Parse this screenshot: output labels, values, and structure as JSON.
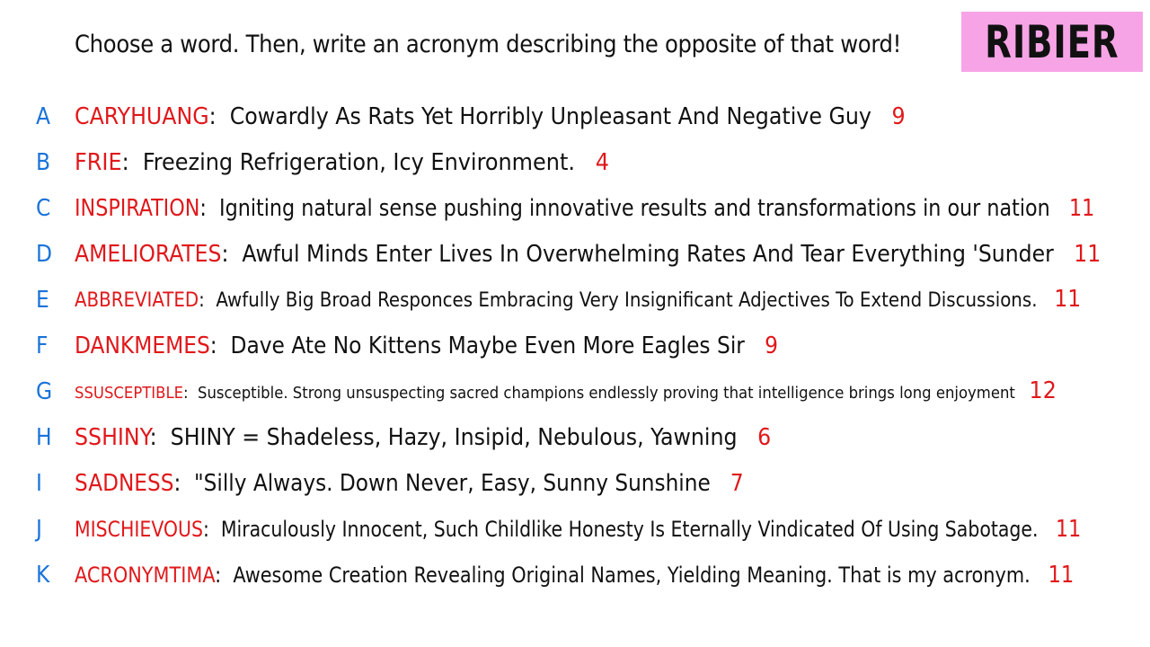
{
  "prompt": "Choose a word. Then, write an acronym describing the opposite of that word!",
  "player_name": "RIBIER",
  "colors": {
    "letter": "#1a73d9",
    "word": "#e0181b",
    "score": "#e0181b",
    "name_tag_bg": "#f7a4e6"
  },
  "answers": [
    {
      "letter": "A",
      "word": "CARYHUANG",
      "definition": "Cowardly As Rats Yet Horribly Unpleasant And Negative Guy",
      "score": "9"
    },
    {
      "letter": "B",
      "word": "FRIE",
      "definition": "Freezing Refrigeration, Icy Environment.",
      "score": "4"
    },
    {
      "letter": "C",
      "word": "INSPIRATION",
      "definition": "Igniting natural sense pushing innovative results and transformations in our nation",
      "score": "11"
    },
    {
      "letter": "D",
      "word": "AMELIORATES",
      "definition": "Awful Minds Enter Lives In Overwhelming Rates And Tear Everything 'Sunder",
      "score": "11"
    },
    {
      "letter": "E",
      "word": "ABBREVIATED",
      "definition": "Awfully Big Broad Responces Embracing Very Insignificant Adjectives To Extend Discussions.",
      "score": "11"
    },
    {
      "letter": "F",
      "word": "DANKMEMES",
      "definition": "Dave Ate No Kittens Maybe Even More Eagles Sir",
      "score": "9"
    },
    {
      "letter": "G",
      "word": "SSUSCEPTIBLE",
      "definition": "Susceptible. Strong unsuspecting sacred champions endlessly proving that intelligence brings long enjoyment",
      "score": "12"
    },
    {
      "letter": "H",
      "word": "SSHINY",
      "definition": "SHINY = Shadeless, Hazy, Insipid, Nebulous, Yawning",
      "score": "6"
    },
    {
      "letter": "I",
      "word": "SADNESS",
      "definition": "\"Silly Always. Down Never, Easy, Sunny Sunshine",
      "score": "7"
    },
    {
      "letter": "J",
      "word": "MISCHIEVOUS",
      "definition": "Miraculously Innocent, Such Childlike Honesty Is Eternally Vindicated Of Using Sabotage.",
      "score": "11"
    },
    {
      "letter": "K",
      "word": "ACRONYMTIMA",
      "definition": "Awesome Creation Revealing Original Names, Yielding Meaning. That is my acronym.",
      "score": "11"
    }
  ]
}
